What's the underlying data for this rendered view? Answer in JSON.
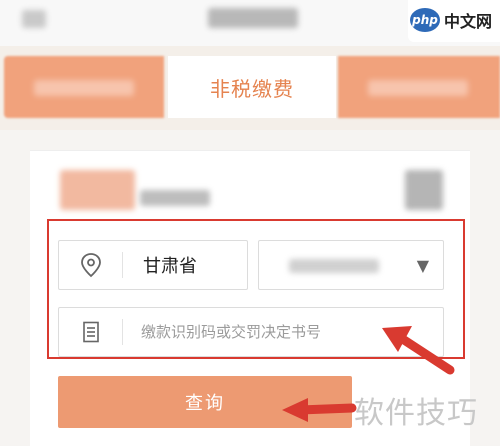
{
  "brand": {
    "badge": "php",
    "label": "中文网"
  },
  "tabs": {
    "active_label": "非税缴费"
  },
  "form": {
    "province_value": "甘肃省",
    "city_caret": "▼",
    "id_placeholder": "缴款识别码或交罚决定书号"
  },
  "actions": {
    "query_label": "查询"
  },
  "watermark_bottom": "软件技巧",
  "colors": {
    "accent": "#e5834f",
    "button": "#ed9a72",
    "highlight": "#d93a30"
  }
}
